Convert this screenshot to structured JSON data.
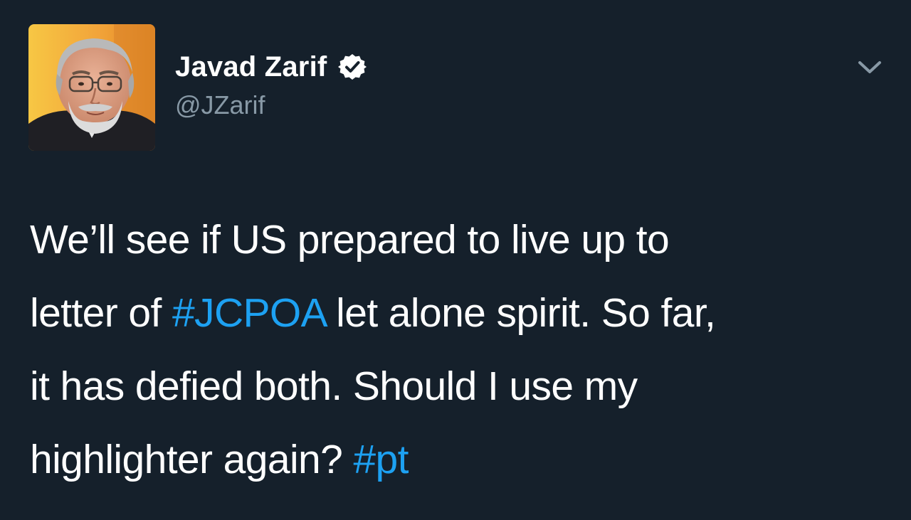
{
  "tweet": {
    "display_name": "Javad Zarif",
    "handle": "@JZarif",
    "verified": true,
    "body": {
      "line1": "We’ll see if US prepared to live up to",
      "line2_pre": "letter of ",
      "hashtag1": "#JCPOA",
      "line2_post": " let alone spirit. So far,",
      "line3": "it has defied both. Should I use my",
      "line4_pre": "highlighter again? ",
      "hashtag2": "#pt"
    }
  },
  "colors": {
    "background": "#15202b",
    "text": "#ffffff",
    "secondary_text": "#8899a6",
    "link": "#1da1f2"
  },
  "icons": {
    "verified": "verified-badge-icon",
    "more": "chevron-down-icon"
  }
}
